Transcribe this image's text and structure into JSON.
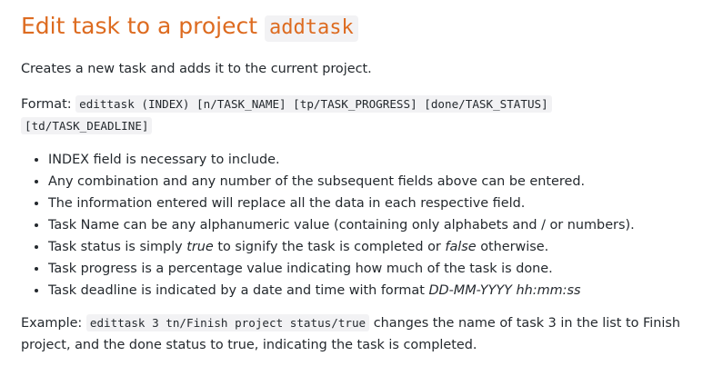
{
  "heading": {
    "text": "Edit task to a project",
    "code": "addtask"
  },
  "description": "Creates a new task and adds it to the current project.",
  "format": {
    "label": "Format:",
    "code_line1": "edittask (INDEX) [n/TASK_NAME] [tp/TASK_PROGRESS] [done/TASK_STATUS]",
    "code_line2": "[td/TASK_DEADLINE]"
  },
  "bullets": [
    {
      "text": "INDEX field is necessary to include."
    },
    {
      "text": "Any combination and any number of the subsequent fields above can be entered."
    },
    {
      "text": "The information entered will replace all the data in each respective field."
    },
    {
      "text": "Task Name can be any alphanumeric value (containing only alphabets and / or numbers)."
    },
    {
      "pre": "Task status is simply ",
      "em1": "true",
      "mid": " to signify the task is completed or ",
      "em2": "false",
      "post": " otherwise."
    },
    {
      "text": "Task progress is a percentage value indicating how much of the task is done."
    },
    {
      "pre": "Task deadline is indicated by a date and time with format ",
      "em1": "DD-MM-YYYY hh:mm:ss"
    }
  ],
  "example": {
    "label": "Example:",
    "code": "edittask 3 tn/Finish project status/true",
    "text": " changes the name of task 3 in the list to Finish project, and the done status to true, indicating the task is completed."
  },
  "colors": {
    "heading": "#dd6b20",
    "text": "#24292e",
    "code_background": "#f2f2f4"
  }
}
